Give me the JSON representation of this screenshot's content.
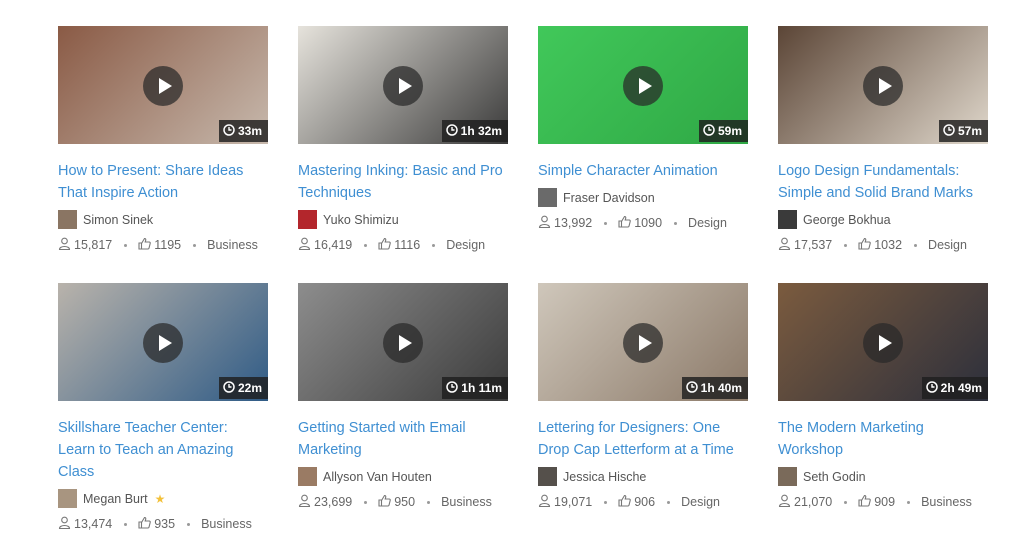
{
  "courses": [
    {
      "title": "How to Present: Share Ideas That Inspire Action",
      "author": "Simon Sinek",
      "duration": "33m",
      "students": "15,817",
      "likes": "1195",
      "category": "Business",
      "thumb_colors": [
        "#8a5a45",
        "#c7b9ad"
      ],
      "avatar_color": "#8a7563"
    },
    {
      "title": "Mastering Inking: Basic and Pro Techniques",
      "author": "Yuko Shimizu",
      "duration": "1h 32m",
      "students": "16,419",
      "likes": "1116",
      "category": "Design",
      "thumb_colors": [
        "#e6e3dc",
        "#3a3a3a"
      ],
      "avatar_color": "#b3262c"
    },
    {
      "title": "Simple Character Animation",
      "author": "Fraser Davidson",
      "duration": "59m",
      "students": "13,992",
      "likes": "1090",
      "category": "Design",
      "thumb_colors": [
        "#41c85a",
        "#2fa845"
      ],
      "avatar_color": "#6a6a6a"
    },
    {
      "title": "Logo Design Fundamentals: Simple and Solid Brand Marks",
      "author": "George Bokhua",
      "duration": "57m",
      "students": "17,537",
      "likes": "1032",
      "category": "Design",
      "thumb_colors": [
        "#5b4536",
        "#e0d8cc"
      ],
      "avatar_color": "#3a3a3a"
    },
    {
      "title": "Skillshare Teacher Center: Learn to Teach an Amazing Class",
      "author": "Megan Burt",
      "duration": "22m",
      "students": "13,474",
      "likes": "935",
      "category": "Business",
      "thumb_colors": [
        "#b9b3ab",
        "#2f5b86"
      ],
      "avatar_color": "#a89580",
      "author_starred": true,
      "star": "★"
    },
    {
      "title": "Getting Started with Email Marketing",
      "author": "Allyson Van Houten",
      "duration": "1h 11m",
      "students": "23,699",
      "likes": "950",
      "category": "Business",
      "thumb_colors": [
        "#8d8d8d",
        "#3b3b3b"
      ],
      "avatar_color": "#9a7b64"
    },
    {
      "title": "Lettering for Designers: One Drop Cap Letterform at a Time",
      "author": "Jessica Hische",
      "duration": "1h 40m",
      "students": "19,071",
      "likes": "906",
      "category": "Design",
      "thumb_colors": [
        "#cfc7bb",
        "#8b7968"
      ],
      "avatar_color": "#55504b"
    },
    {
      "title": "The Modern Marketing Workshop",
      "author": "Seth Godin",
      "duration": "2h 49m",
      "students": "21,070",
      "likes": "909",
      "category": "Business",
      "thumb_colors": [
        "#7b5b3e",
        "#2c2f3c"
      ],
      "avatar_color": "#7a6a5a"
    }
  ]
}
